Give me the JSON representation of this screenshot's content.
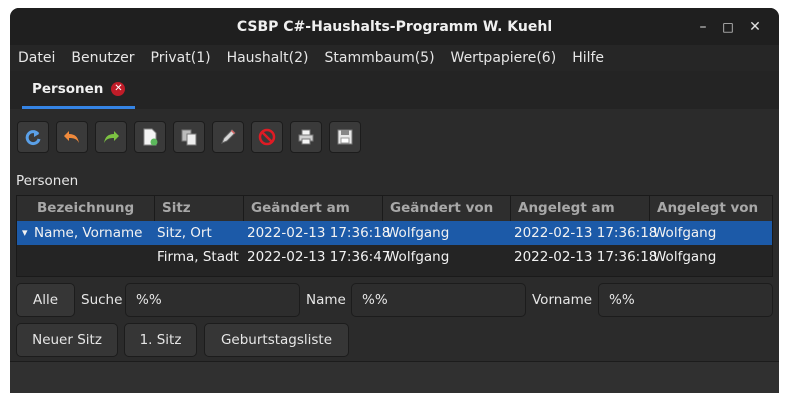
{
  "window": {
    "title": "CSBP C#-Haushalts-Programm W. Kuehl",
    "controls": {
      "minimize": "–",
      "maximize": "□",
      "close": "✕"
    }
  },
  "menu": [
    {
      "label": "Datei"
    },
    {
      "label": "Benutzer"
    },
    {
      "label": "Privat(1)"
    },
    {
      "label": "Haushalt(2)"
    },
    {
      "label": "Stammbaum(5)"
    },
    {
      "label": "Wertpapiere(6)"
    },
    {
      "label": "Hilfe"
    }
  ],
  "tab": {
    "label": "Personen",
    "close_icon": "✕"
  },
  "toolbar": {
    "buttons": [
      {
        "icon": "refresh-icon"
      },
      {
        "icon": "undo-icon"
      },
      {
        "icon": "redo-icon"
      },
      {
        "icon": "new-document-icon"
      },
      {
        "icon": "copy-icon"
      },
      {
        "icon": "edit-icon"
      },
      {
        "icon": "delete-icon"
      },
      {
        "icon": "print-icon"
      },
      {
        "icon": "save-icon"
      }
    ]
  },
  "section_label": "Personen",
  "table": {
    "columns": [
      "Bezeichnung",
      "Sitz",
      "Geändert am",
      "Geändert von",
      "Angelegt am",
      "Angelegt von"
    ],
    "rows": [
      {
        "bezeichnung": "Name, Vorname",
        "sitz": "Sitz, Ort",
        "geaendert_am": "2022-02-13 17:36:18",
        "geaendert_von": "Wolfgang",
        "angelegt_am": "2022-02-13 17:36:18",
        "angelegt_von": "Wolfgang",
        "expander": "▾"
      },
      {
        "bezeichnung": "",
        "sitz": "Firma, Stadt",
        "geaendert_am": "2022-02-13 17:36:47",
        "geaendert_von": "Wolfgang",
        "angelegt_am": "2022-02-13 17:36:18",
        "angelegt_von": "Wolfgang"
      }
    ]
  },
  "filters": {
    "all_button": "Alle",
    "search_label": "Suche",
    "search_value": "%%",
    "name_label": "Name",
    "name_value": "%%",
    "vorname_label": "Vorname",
    "vorname_value": "%%"
  },
  "actions": {
    "new_seat": "Neuer Sitz",
    "first_seat": "1. Sitz",
    "birthday_list": "Geburtstagsliste"
  },
  "colors": {
    "accent": "#3584e4",
    "selection": "#1c5aa8",
    "close_badge": "#c01c28"
  }
}
